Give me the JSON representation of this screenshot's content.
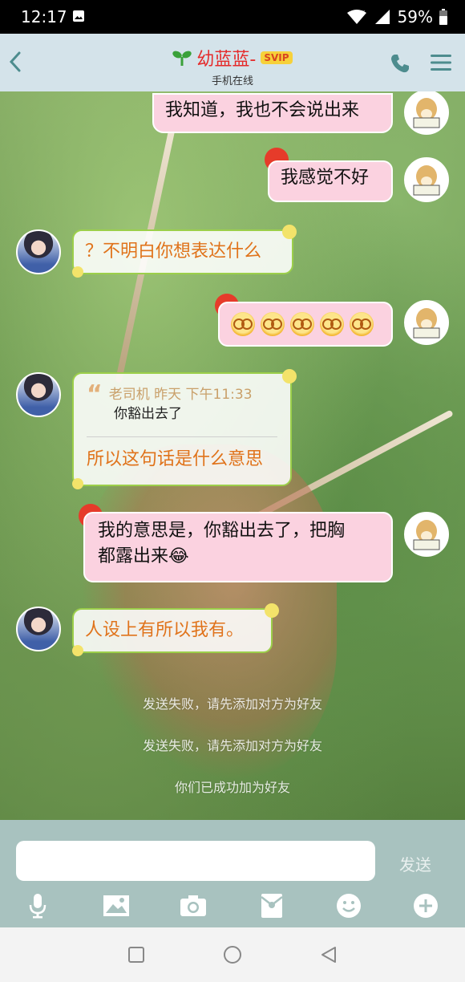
{
  "status_bar": {
    "time": "12:17",
    "battery": "59%"
  },
  "header": {
    "title": "幼蓝蓝-",
    "badge": "SVIP",
    "subtitle": "手机在线"
  },
  "messages": {
    "m1": "我知道，我也不会说出来",
    "m2": "我感觉不好",
    "m3": "？不明白你想表达什么",
    "m5_quote_meta": "老司机 昨天 下午11:33",
    "m5_quote_text": "你豁出去了",
    "m5_reply": "所以这句话是什么意思",
    "m6_line1": "我的意思是，你豁出去了，把胸",
    "m6_line2": "都露出来😂",
    "m7": "人设上有所以我有。"
  },
  "system_messages": [
    "发送失败，请先添加对方为好友",
    "发送失败，请先添加对方为好友",
    "你们已成功加为好友"
  ],
  "input": {
    "value": "",
    "send_label": "发送"
  },
  "colors": {
    "header_bg": "#d4e3ea",
    "title_red": "#e52a2a",
    "bubble_right": "#fbd2e0",
    "bubble_left_text": "#e0731b",
    "input_area_bg": "#a8c2bf"
  }
}
